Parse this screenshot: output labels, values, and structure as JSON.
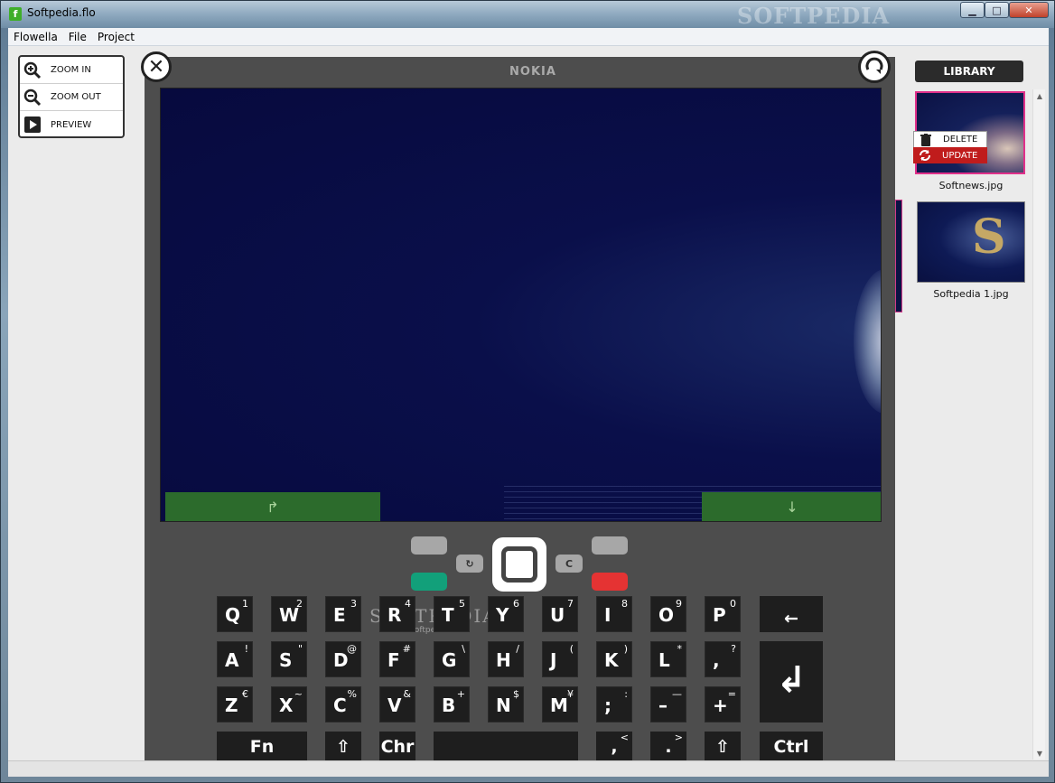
{
  "window": {
    "title": "Softpedia.flo",
    "watermark": "SOFTPEDIA"
  },
  "menu": [
    "Flowella",
    "File",
    "Project"
  ],
  "tools": [
    {
      "label": "ZOOM IN",
      "icon": "zoom-in-icon"
    },
    {
      "label": "ZOOM OUT",
      "icon": "zoom-out-icon"
    },
    {
      "label": "PREVIEW",
      "icon": "play-icon"
    }
  ],
  "phone": {
    "brand": "NOKIA",
    "softkey_left": "↱",
    "softkey_right": "↓",
    "watermark": "SOFTPEDIA",
    "watermark_url": "www.softpedia.com",
    "nav_left_small": "↻",
    "nav_right_small": "C",
    "colors": {
      "call": "#12a07a",
      "end": "#e53333"
    }
  },
  "keyboard": {
    "row1": [
      {
        "k": "Q",
        "s": "1"
      },
      {
        "k": "W",
        "s": "2"
      },
      {
        "k": "E",
        "s": "3"
      },
      {
        "k": "R",
        "s": "4"
      },
      {
        "k": "T",
        "s": "5"
      },
      {
        "k": "Y",
        "s": "6"
      },
      {
        "k": "U",
        "s": "7"
      },
      {
        "k": "I",
        "s": "8"
      },
      {
        "k": "O",
        "s": "9"
      },
      {
        "k": "P",
        "s": "0"
      }
    ],
    "row2": [
      {
        "k": "A",
        "s": "!"
      },
      {
        "k": "S",
        "s": "\""
      },
      {
        "k": "D",
        "s": "@"
      },
      {
        "k": "F",
        "s": "#"
      },
      {
        "k": "G",
        "s": "\\"
      },
      {
        "k": "H",
        "s": "/"
      },
      {
        "k": "J",
        "s": "("
      },
      {
        "k": "K",
        "s": ")"
      },
      {
        "k": "L",
        "s": "*"
      },
      {
        "k": ",",
        "s": "?"
      }
    ],
    "row3": [
      {
        "k": "Z",
        "s": "€"
      },
      {
        "k": "X",
        "s": "~"
      },
      {
        "k": "C",
        "s": "%"
      },
      {
        "k": "V",
        "s": "&"
      },
      {
        "k": "B",
        "s": "+"
      },
      {
        "k": "N",
        "s": "$"
      },
      {
        "k": "M",
        "s": "¥"
      },
      {
        "k": ";",
        "s": ":"
      },
      {
        "k": "–",
        "s": "—"
      },
      {
        "k": "+",
        "s": "="
      }
    ],
    "row4": [
      {
        "k": "Fn"
      },
      {
        "k": "⇧"
      },
      {
        "k": "Chr"
      },
      {
        "k": ""
      },
      {
        "k": ",",
        "s": "<"
      },
      {
        "k": ".",
        "s": ">"
      },
      {
        "k": "⇧"
      },
      {
        "k": "Ctrl"
      }
    ],
    "backspace": "←",
    "enter": "↲"
  },
  "library": {
    "header": "LIBRARY",
    "items": [
      {
        "label": "Softnews.jpg",
        "selected": true
      },
      {
        "label": "Softpedia 1.jpg",
        "selected": false
      }
    ],
    "context_menu": {
      "delete": "DELETE",
      "update": "UPDATE"
    }
  }
}
